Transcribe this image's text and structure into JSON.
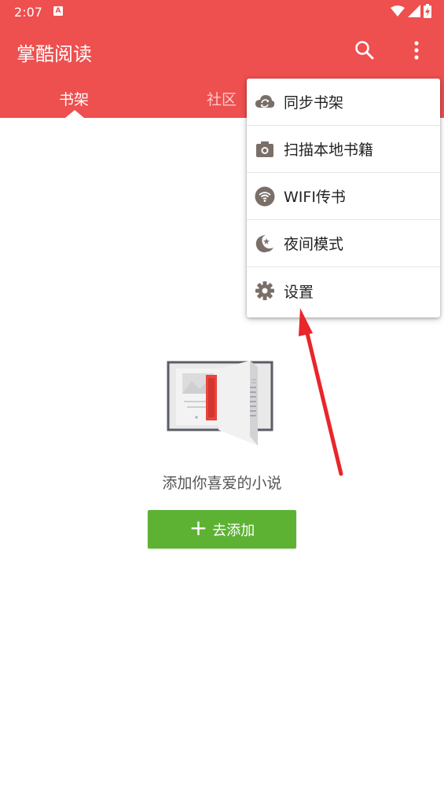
{
  "status": {
    "time": "2:07",
    "badge": "A"
  },
  "appbar": {
    "title": "掌酷阅读",
    "search_icon": "search-icon",
    "more_icon": "more-vert-icon"
  },
  "tabs": [
    {
      "label": "书架"
    },
    {
      "label": "社区"
    }
  ],
  "empty": {
    "message": "添加你喜爱的小说",
    "add_button": {
      "plus": "+",
      "label": "去添加"
    }
  },
  "menu": {
    "items": [
      {
        "label": "同步书架",
        "icon": "cloud-sync-icon"
      },
      {
        "label": "扫描本地书籍",
        "icon": "camera-icon"
      },
      {
        "label": "WIFI传书",
        "icon": "wifi-icon"
      },
      {
        "label": "夜间模式",
        "icon": "moon-icon"
      },
      {
        "label": "设置",
        "icon": "gear-icon"
      }
    ]
  },
  "colors": {
    "primary": "#ee4f4f",
    "button_green": "#5db234",
    "arrow": "#e8262b"
  }
}
